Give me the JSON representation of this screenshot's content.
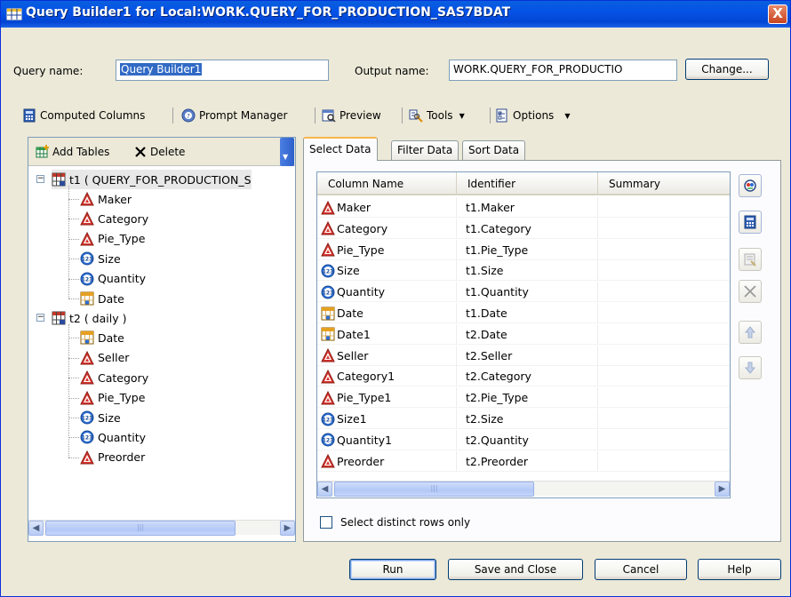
{
  "window": {
    "title": "Query Builder1 for Local:WORK.QUERY_FOR_PRODUCTION_SAS7BDAT",
    "close_glyph": "X"
  },
  "query_name": {
    "label": "Query name:",
    "value": "Query Builder1"
  },
  "output_name": {
    "label": "Output name:",
    "value": "WORK.QUERY_FOR_PRODUCTIO",
    "change_label": "Change..."
  },
  "toolbar": {
    "computed_columns": "Computed Columns",
    "prompt_manager": "Prompt Manager",
    "preview": "Preview",
    "tools": "Tools",
    "options": "Options"
  },
  "left_panel": {
    "add_tables": "Add Tables",
    "delete": "Delete",
    "tables": [
      {
        "label": "t1 ( QUERY_FOR_PRODUCTION_S",
        "columns": [
          {
            "name": "Maker",
            "type": "char"
          },
          {
            "name": "Category",
            "type": "char"
          },
          {
            "name": "Pie_Type",
            "type": "char"
          },
          {
            "name": "Size",
            "type": "num"
          },
          {
            "name": "Quantity",
            "type": "num"
          },
          {
            "name": "Date",
            "type": "date"
          }
        ]
      },
      {
        "label": "t2 ( daily )",
        "columns": [
          {
            "name": "Date",
            "type": "date"
          },
          {
            "name": "Seller",
            "type": "char"
          },
          {
            "name": "Category",
            "type": "char"
          },
          {
            "name": "Pie_Type",
            "type": "char"
          },
          {
            "name": "Size",
            "type": "num"
          },
          {
            "name": "Quantity",
            "type": "num"
          },
          {
            "name": "Preorder",
            "type": "char"
          }
        ]
      }
    ]
  },
  "tabs": [
    {
      "label": "Select Data",
      "active": true
    },
    {
      "label": "Filter Data",
      "active": false
    },
    {
      "label": "Sort Data",
      "active": false
    }
  ],
  "grid": {
    "headers": [
      "Column Name",
      "Identifier",
      "Summary"
    ],
    "rows": [
      {
        "name": "Maker",
        "identifier": "t1.Maker",
        "summary": "",
        "type": "char"
      },
      {
        "name": "Category",
        "identifier": "t1.Category",
        "summary": "",
        "type": "char"
      },
      {
        "name": "Pie_Type",
        "identifier": "t1.Pie_Type",
        "summary": "",
        "type": "char"
      },
      {
        "name": "Size",
        "identifier": "t1.Size",
        "summary": "",
        "type": "num"
      },
      {
        "name": "Quantity",
        "identifier": "t1.Quantity",
        "summary": "",
        "type": "num"
      },
      {
        "name": "Date",
        "identifier": "t1.Date",
        "summary": "",
        "type": "date"
      },
      {
        "name": "Date1",
        "identifier": "t2.Date",
        "summary": "",
        "type": "date"
      },
      {
        "name": "Seller",
        "identifier": "t2.Seller",
        "summary": "",
        "type": "char"
      },
      {
        "name": "Category1",
        "identifier": "t2.Category",
        "summary": "",
        "type": "char"
      },
      {
        "name": "Pie_Type1",
        "identifier": "t2.Pie_Type",
        "summary": "",
        "type": "char"
      },
      {
        "name": "Size1",
        "identifier": "t2.Size",
        "summary": "",
        "type": "num"
      },
      {
        "name": "Quantity1",
        "identifier": "t2.Quantity",
        "summary": "",
        "type": "num"
      },
      {
        "name": "Preorder",
        "identifier": "t2.Preorder",
        "summary": "",
        "type": "char"
      }
    ]
  },
  "select_distinct": {
    "label": "Select distinct rows only",
    "checked": false
  },
  "buttons": {
    "run": "Run",
    "save_close": "Save and Close",
    "cancel": "Cancel",
    "help": "Help"
  },
  "icons": {
    "char": "char-column-icon",
    "num": "numeric-column-icon",
    "date": "date-column-icon",
    "num_glyph": "123"
  },
  "colors": {
    "title_bar": "#0453e6",
    "char_icon": "#d8342c",
    "num_icon": "#2a6fd6",
    "date_icon": "#e6a020"
  }
}
